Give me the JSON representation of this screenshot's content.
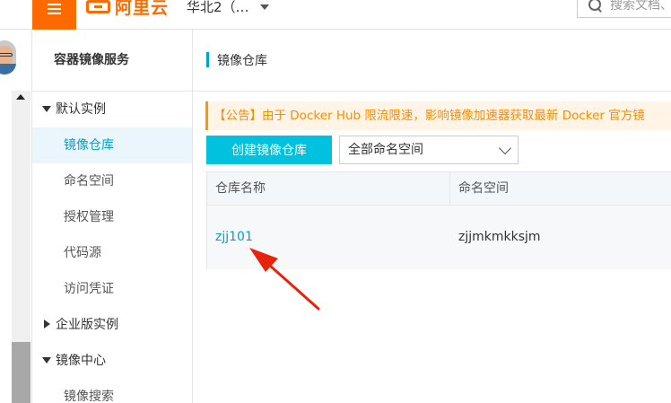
{
  "topbar": {
    "logo_text": "阿里云",
    "region": "华北2（…",
    "search_placeholder": "搜索文档、"
  },
  "sidebar": {
    "title": "容器镜像服务",
    "groups": [
      {
        "label": "默认实例",
        "expanded": true
      },
      {
        "label": "企业版实例",
        "expanded": false
      },
      {
        "label": "镜像中心",
        "expanded": true
      }
    ],
    "items": [
      {
        "label": "镜像仓库",
        "active": true
      },
      {
        "label": "命名空间"
      },
      {
        "label": "授权管理"
      },
      {
        "label": "代码源"
      },
      {
        "label": "访问凭证"
      },
      {
        "label": "镜像搜索"
      }
    ]
  },
  "main": {
    "page_title": "镜像仓库",
    "notice": "【公告】由于 Docker Hub 限流限速，影响镜像加速器获取最新 Docker 官方镜",
    "create_button": "创建镜像仓库",
    "namespace_select": "全部命名空间",
    "table": {
      "columns": [
        "仓库名称",
        "命名空间"
      ],
      "rows": [
        {
          "name": "zjj101",
          "namespace": "zjjmkmkksjm"
        }
      ]
    }
  },
  "colors": {
    "brand": "#ff6a00",
    "accent": "#00c1de",
    "link": "#00a2ca",
    "notice": "#ff8a00",
    "annotation_arrow": "#e8230c"
  },
  "icons": [
    "menu-icon",
    "aliyun-logo-icon",
    "caret-down-icon",
    "search-icon",
    "chevron-down-icon",
    "triangle-down-icon",
    "triangle-right-icon",
    "annotation-arrow-icon"
  ]
}
